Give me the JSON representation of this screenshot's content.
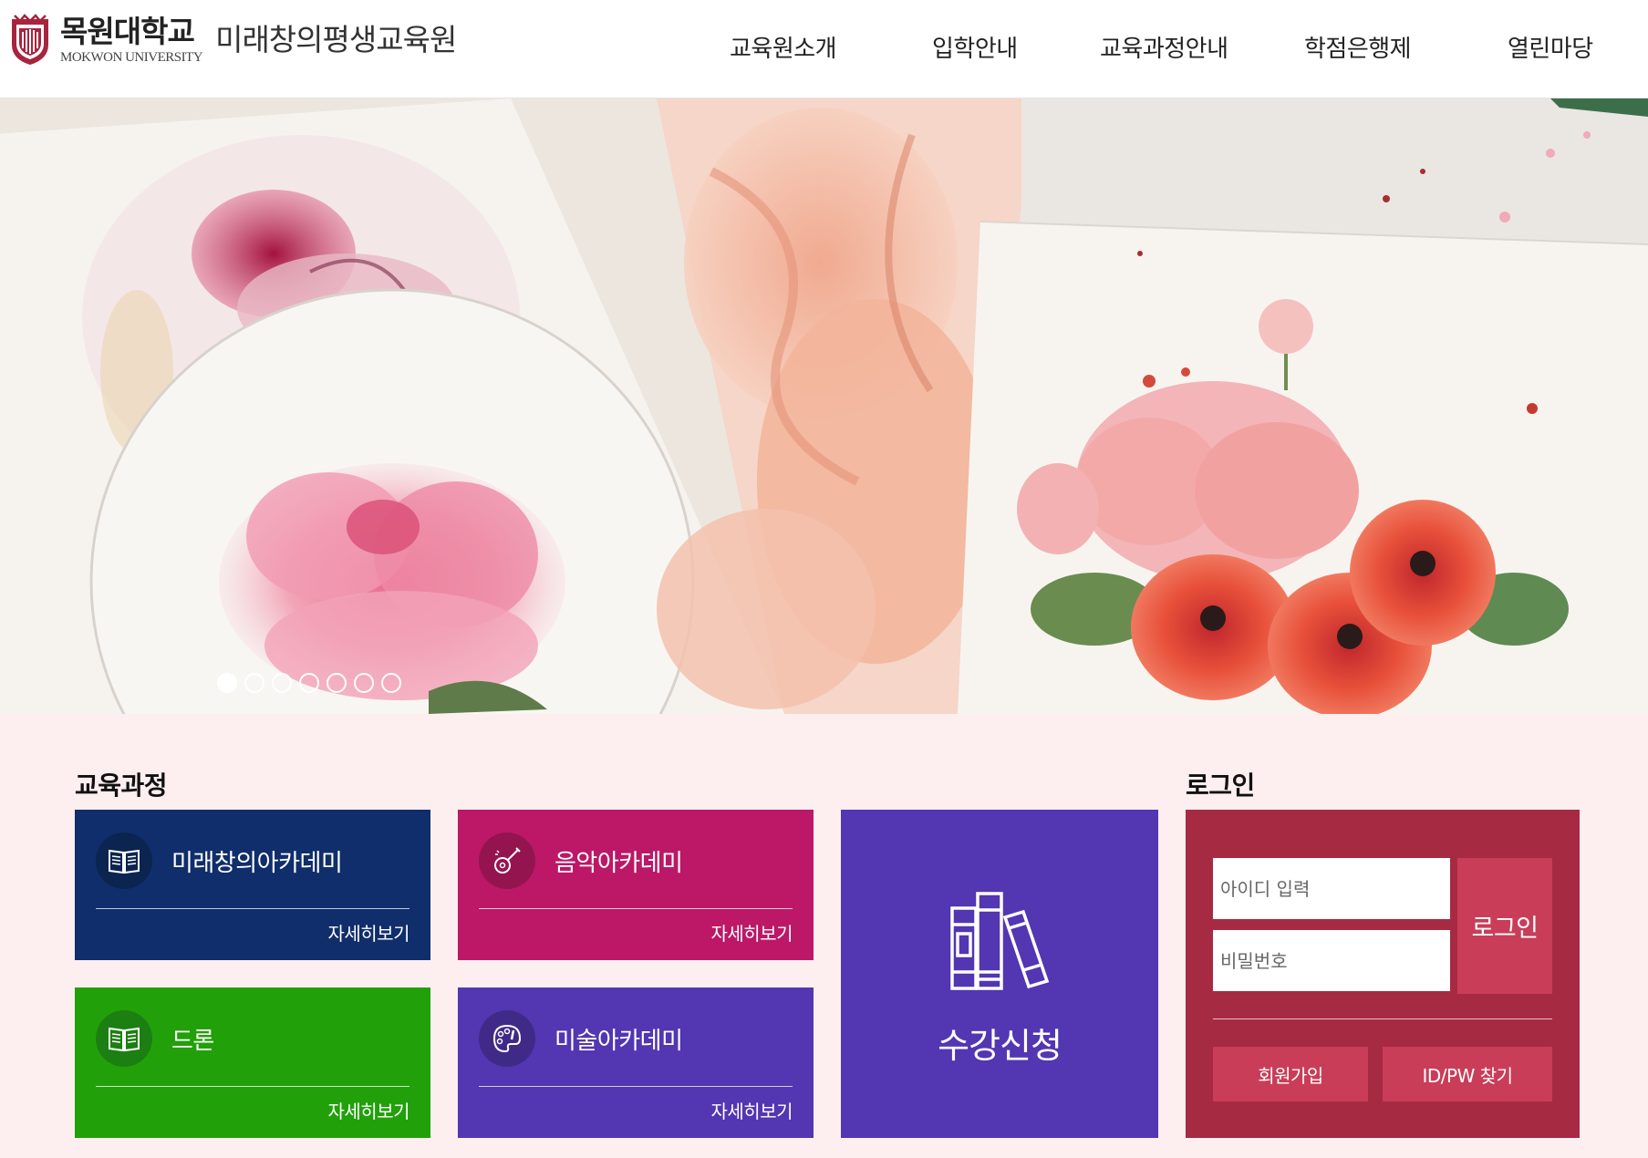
{
  "header": {
    "university_ko": "목원대학교",
    "university_en": "MOKWON UNIVERSITY",
    "institute": "미래창의평생교육원",
    "nav": [
      "교육원소개",
      "입학안내",
      "교육과정안내",
      "학점은행제",
      "열린마당"
    ]
  },
  "hero": {
    "slide_count": 7,
    "active_slide": 1
  },
  "courses": {
    "title": "교육과정",
    "more_label": "자세히보기",
    "items": [
      {
        "label": "미래창의아카데미",
        "icon": "book-icon",
        "color": "#0f2e6b",
        "icon_bg": "#0b2450"
      },
      {
        "label": "음악아카데미",
        "icon": "guitar-icon",
        "color": "#bc1867",
        "icon_bg": "#941450"
      },
      {
        "label": "드론",
        "icon": "book-icon",
        "color": "#21a00a",
        "icon_bg": "#1c7f12"
      },
      {
        "label": "미술아카데미",
        "icon": "palette-icon",
        "color": "#5236b2",
        "icon_bg": "#3f2a88"
      }
    ]
  },
  "apply": {
    "label": "수강신청",
    "icon": "books-icon",
    "color": "#5236b2"
  },
  "login": {
    "title": "로그인",
    "id_placeholder": "아이디 입력",
    "pw_placeholder": "비밀번호",
    "login_button": "로그인",
    "signup_button": "회원가입",
    "find_button": "ID/PW 찾기",
    "color": "#a72a43",
    "button_color": "#c93d58"
  },
  "colors": {
    "section_bg": "#fdeef0"
  }
}
